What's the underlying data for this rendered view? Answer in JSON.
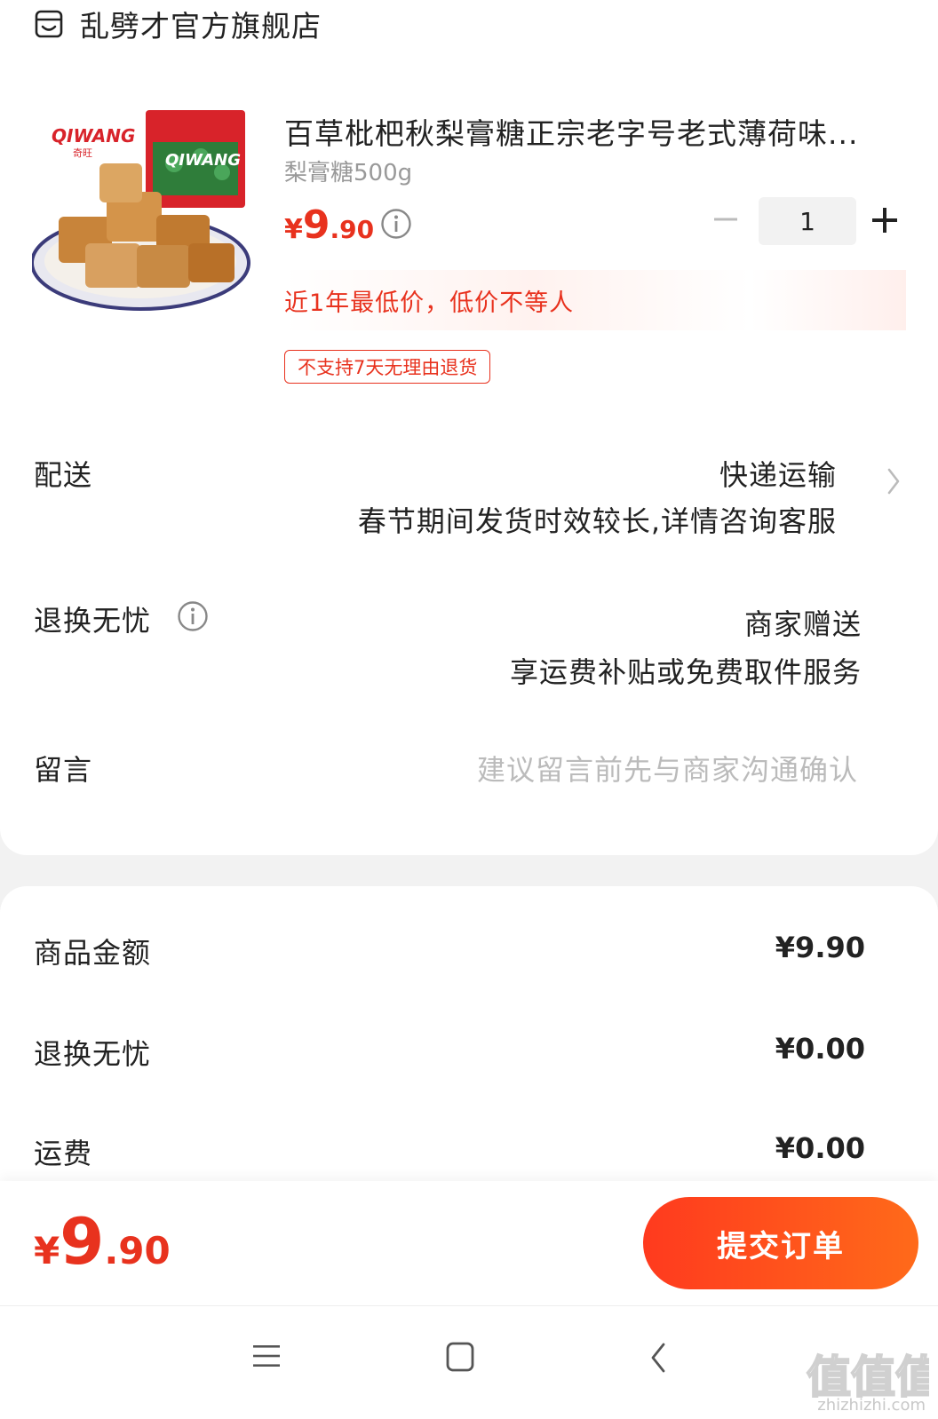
{
  "shop": {
    "name": "乱劈才官方旗舰店",
    "icon": "store-icon"
  },
  "product": {
    "title": "百草枇杷秋梨膏糖正宗老字号老式薄荷味...",
    "spec": "梨膏糖500g",
    "price_symbol": "¥",
    "price_int": "9",
    "price_dec": ".90",
    "quantity": "1",
    "promo": "近1年最低价，低价不等人",
    "tag": "不支持7天无理由退货",
    "image_brand": "QIWANG",
    "image_brand_cn": "奇旺"
  },
  "delivery": {
    "label": "配送",
    "method": "快递运输",
    "note": "春节期间发货时效较长,详情咨询客服"
  },
  "worry_free": {
    "label": "退换无忧",
    "value": "商家赠送",
    "note": "享运费补贴或免费取件服务"
  },
  "message": {
    "label": "留言",
    "placeholder": "建议留言前先与商家沟通确认"
  },
  "summary": {
    "goods_label": "商品金额",
    "goods_value": "¥9.90",
    "worry_label": "退换无忧",
    "worry_value": "¥0.00",
    "shipping_label": "运费",
    "shipping_value": "¥0.00"
  },
  "footer": {
    "total_symbol": "¥",
    "total_int": "9",
    "total_dec": ".90",
    "submit_label": "提交订单"
  },
  "watermark": {
    "logo": "值值值",
    "text": "zhizhizhi.com"
  },
  "colors": {
    "accent": "#e8321e",
    "button_start": "#ff3a1e",
    "button_end": "#ff6a1a"
  }
}
